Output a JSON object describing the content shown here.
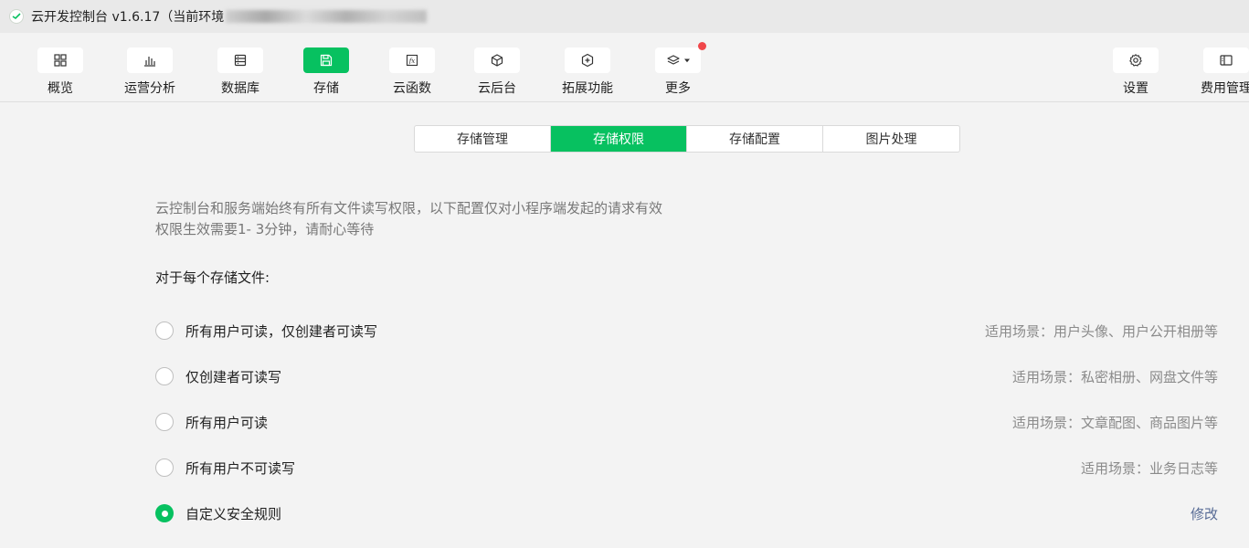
{
  "titlebar": {
    "title": "云开发控制台 v1.6.17（当前环境"
  },
  "toolbar": {
    "items": [
      {
        "label": "概览",
        "icon": "grid-icon"
      },
      {
        "label": "运营分析",
        "icon": "bar-chart-icon"
      },
      {
        "label": "数据库",
        "icon": "database-icon"
      },
      {
        "label": "存储",
        "icon": "save-icon"
      },
      {
        "label": "云函数",
        "icon": "function-icon"
      },
      {
        "label": "云后台",
        "icon": "cube-icon"
      },
      {
        "label": "拓展功能",
        "icon": "extension-icon"
      },
      {
        "label": "更多",
        "icon": "layers-icon"
      },
      {
        "label": "设置",
        "icon": "gear-icon"
      },
      {
        "label": "费用管理",
        "icon": "billing-icon"
      }
    ],
    "active_color": "#07c160",
    "badge_color": "#f0474a"
  },
  "tabs": [
    {
      "label": "存储管理"
    },
    {
      "label": "存储权限"
    },
    {
      "label": "存储配置"
    },
    {
      "label": "图片处理"
    }
  ],
  "description": {
    "line1": "云控制台和服务端始终有所有文件读写权限，以下配置仅对小程序端发起的请求有效",
    "line2": "权限生效需要1- 3分钟，请耐心等待"
  },
  "section_title": "对于每个存储文件:",
  "options": [
    {
      "label": "所有用户可读，仅创建者可读写",
      "hint": "适用场景：用户头像、用户公开相册等",
      "checked": false
    },
    {
      "label": "仅创建者可读写",
      "hint": "适用场景：私密相册、网盘文件等",
      "checked": false
    },
    {
      "label": "所有用户可读",
      "hint": "适用场景：文章配图、商品图片等",
      "checked": false
    },
    {
      "label": "所有用户不可读写",
      "hint": "适用场景：业务日志等",
      "checked": false
    },
    {
      "label": "自定义安全规则",
      "hint": "修改",
      "checked": true
    }
  ]
}
